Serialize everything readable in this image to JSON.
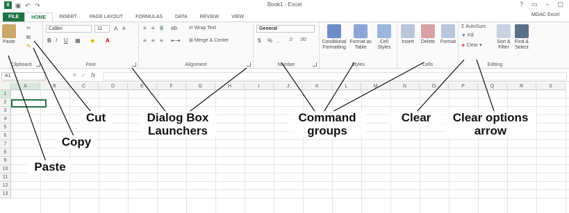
{
  "window": {
    "title": "Book1 - Excel",
    "controls": [
      "?",
      "▭",
      "–",
      "▢"
    ]
  },
  "qat": {
    "logo": "X",
    "icons": [
      "save-icon",
      "undo-icon",
      "redo-icon"
    ]
  },
  "tabs": [
    "FILE",
    "HOME",
    "INSERT",
    "PAGE LAYOUT",
    "FORMULAS",
    "DATA",
    "REVIEW",
    "VIEW"
  ],
  "account": "MOAC Excel",
  "ribbon": {
    "clipboard": {
      "label": "Clipboard",
      "paste": "Paste"
    },
    "font": {
      "label": "Font",
      "name": "Calibri",
      "size": "11",
      "bold": "B",
      "italic": "I",
      "underline": "U",
      "grow": "A",
      "shrink": "A"
    },
    "alignment": {
      "label": "Alignment",
      "wrap": "Wrap Text",
      "merge": "Merge & Center"
    },
    "number": {
      "label": "Number",
      "format": "General",
      "dollar": "$",
      "percent": "%",
      "comma": ","
    },
    "styles": {
      "label": "Styles",
      "cond": "Conditional Formatting",
      "table": "Format as Table",
      "cell": "Cell Styles"
    },
    "cells": {
      "label": "Cells",
      "insert": "Insert",
      "delete": "Delete",
      "format": "Format"
    },
    "editing": {
      "label": "Editing",
      "autosum": "AutoSum",
      "fill": "Fill",
      "clear": "Clear",
      "sort": "Sort & Filter",
      "find": "Find & Select"
    }
  },
  "formula_bar": {
    "name_box": "A1",
    "cancel": "✕",
    "enter": "✓",
    "fx": "fx"
  },
  "columns": [
    "A",
    "B",
    "C",
    "D",
    "E",
    "F",
    "G",
    "H",
    "I",
    "J",
    "K",
    "L",
    "M",
    "N",
    "O",
    "P",
    "Q",
    "R",
    "S"
  ],
  "rows": [
    "1",
    "2",
    "3",
    "4",
    "5",
    "6",
    "7",
    "8",
    "9",
    "10",
    "11",
    "12",
    "13"
  ],
  "callouts": {
    "cut": "Cut",
    "copy": "Copy",
    "paste": "Paste",
    "dialog": "Dialog Box Launchers",
    "command": "Command groups",
    "clear": "Clear",
    "clear_arrow": "Clear options arrow"
  },
  "colors": {
    "accent": "#217346",
    "callout_text": "#111111"
  }
}
